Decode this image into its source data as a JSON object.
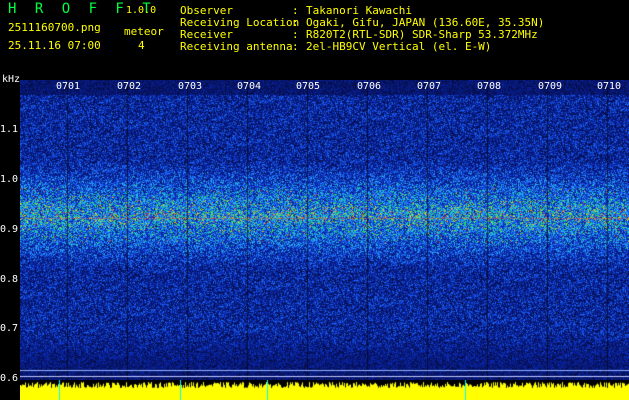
{
  "app": {
    "logo": "H R O F F T",
    "version": "1.0.0"
  },
  "file": {
    "name": "2511160700.png",
    "datetime": "25.11.16 07:00"
  },
  "meteor": {
    "label": "meteor",
    "count": "4"
  },
  "info": [
    {
      "label": "Observer",
      "sep": ":",
      "value": "Takanori Kawachi"
    },
    {
      "label": "Receiving Location",
      "sep": ":",
      "value": "Ogaki, Gifu, JAPAN (136.60E, 35.35N)"
    },
    {
      "label": "Receiver",
      "sep": ":",
      "value": "R820T2(RTL-SDR) SDR-Sharp 53.372MHz"
    },
    {
      "label": "Receiving antenna",
      "sep": ":",
      "value": "2el-HB9CV Vertical (el. E-W)"
    }
  ],
  "axis": {
    "y_unit": "kHz",
    "y_ticks": [
      "1.1",
      "1.0",
      "0.9",
      "0.8",
      "0.7",
      "0.6"
    ],
    "x_ticks": [
      "0701",
      "0702",
      "0703",
      "0704",
      "0705",
      "0706",
      "0707",
      "0708",
      "0709",
      "0710"
    ]
  },
  "colors": {
    "background": "#000000",
    "spectrogram_low": "#08105a",
    "spectrogram_mid": "#0060ff",
    "signal_band": "#00e040",
    "peak": "#ff3010",
    "meter": "#ffff00",
    "marker": "#00ffff"
  }
}
